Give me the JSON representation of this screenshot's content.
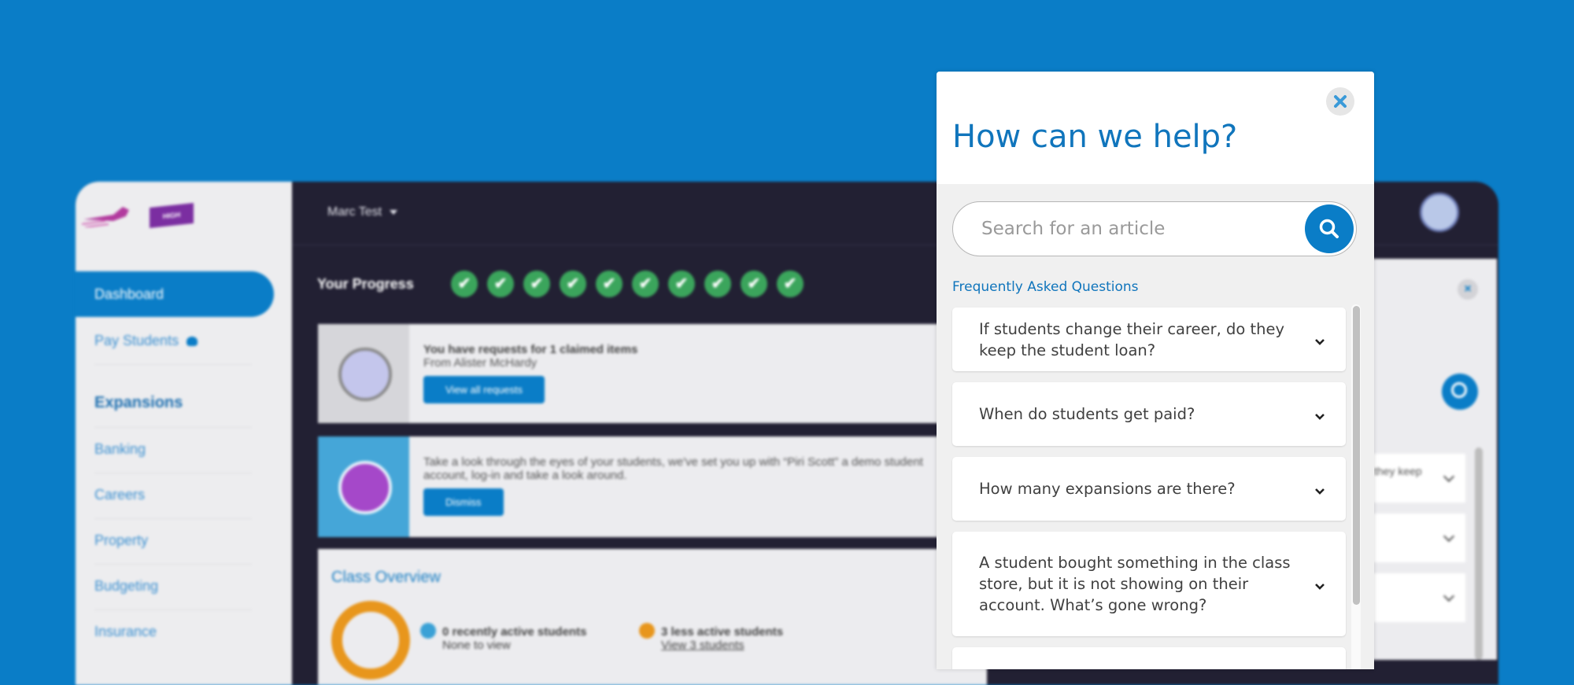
{
  "app": {
    "logo_badge": "HIGH",
    "user_name": "Marc Test",
    "nav": {
      "dashboard": "Dashboard",
      "pay_students": "Pay Students",
      "expansions_heading": "Expansions",
      "items": [
        "Banking",
        "Careers",
        "Property",
        "Budgeting",
        "Insurance"
      ]
    },
    "progress_label": "Your Progress",
    "progress_steps_complete": 10,
    "request_card": {
      "title": "You have requests for 1 claimed items",
      "subtitle": "From Alister McHardy",
      "button": "View all requests"
    },
    "demo_card": {
      "text": "Take a look through the eyes of your students, we've set you up with “Piri Scott” a demo student account, log-in and take a look around.",
      "button": "Dismiss"
    },
    "overview": {
      "title": "Class Overview",
      "stat1_title": "0 recently active students",
      "stat1_sub": "None to view",
      "stat2_title": "3 less active students",
      "stat2_sub": "View 3 students"
    },
    "bg_panel_snippet": "they keep",
    "colors": {
      "accent": "#0a7dc7",
      "sidebar_bg": "#ededef",
      "app_dark": "#222033",
      "success": "#3ba55c",
      "orange": "#e8961c"
    }
  },
  "help": {
    "title": "How can we help?",
    "close_icon": "close-x-icon",
    "search_placeholder": "Search for an article",
    "search_value": "",
    "faq_heading": "Frequently Asked Questions",
    "faqs": [
      {
        "question": "If students change their career, do they keep the student loan?"
      },
      {
        "question": "When do students get paid?"
      },
      {
        "question": "How many expansions are there?"
      },
      {
        "question": "A student bought something in the class store, but it is not showing on their account. What’s gone wrong?"
      }
    ],
    "colors": {
      "title": "#1075bc",
      "search_button": "#0a7dc7"
    }
  }
}
